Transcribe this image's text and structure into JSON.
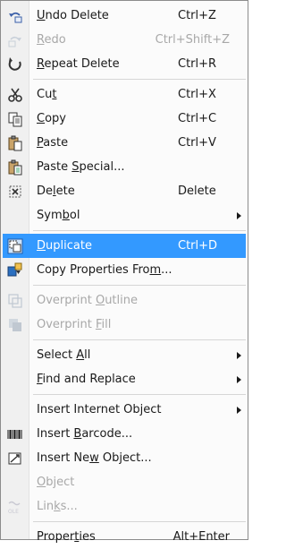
{
  "colors": {
    "highlight": "#3399ff",
    "disabled_text": "#a8a8a8"
  },
  "menu": {
    "groups": [
      [
        {
          "icon": "undo-delete-icon",
          "pre": "",
          "key": "U",
          "post": "ndo Delete",
          "shortcut": "Ctrl+Z",
          "disabled": false
        },
        {
          "icon": "redo-icon",
          "pre": "",
          "key": "R",
          "post": "edo",
          "shortcut": "Ctrl+Shift+Z",
          "disabled": true
        },
        {
          "icon": "repeat-delete-icon",
          "pre": "",
          "key": "R",
          "post": "epeat Delete",
          "shortcut": "Ctrl+R",
          "disabled": false
        }
      ],
      [
        {
          "icon": "scissors-icon",
          "pre": "Cu",
          "key": "t",
          "post": "",
          "shortcut": "Ctrl+X",
          "disabled": false
        },
        {
          "icon": "copy-icon",
          "pre": "",
          "key": "C",
          "post": "opy",
          "shortcut": "Ctrl+C",
          "disabled": false
        },
        {
          "icon": "paste-icon",
          "pre": "",
          "key": "P",
          "post": "aste",
          "shortcut": "Ctrl+V",
          "disabled": false
        },
        {
          "icon": "paste-special-icon",
          "pre": "Paste ",
          "key": "S",
          "post": "pecial...",
          "shortcut": "",
          "disabled": false
        },
        {
          "icon": "delete-icon",
          "pre": "De",
          "key": "l",
          "post": "ete",
          "shortcut": "Delete",
          "disabled": false
        },
        {
          "icon": "",
          "pre": "Sym",
          "key": "b",
          "post": "ol",
          "shortcut": "",
          "submenu": true,
          "disabled": false
        }
      ],
      [
        {
          "icon": "duplicate-icon",
          "pre": "",
          "key": "D",
          "post": "uplicate",
          "shortcut": "Ctrl+D",
          "disabled": false,
          "highlight": true
        },
        {
          "icon": "copy-properties-icon",
          "pre": "Copy Properties Fro",
          "key": "m",
          "post": "...",
          "shortcut": "",
          "disabled": false
        }
      ],
      [
        {
          "icon": "overprint-outline-icon",
          "pre": "Overprint ",
          "key": "O",
          "post": "utline",
          "shortcut": "",
          "disabled": true
        },
        {
          "icon": "overprint-fill-icon",
          "pre": "Overprint ",
          "key": "F",
          "post": "ill",
          "shortcut": "",
          "disabled": true
        }
      ],
      [
        {
          "icon": "",
          "pre": "Select ",
          "key": "A",
          "post": "ll",
          "shortcut": "",
          "submenu": true,
          "disabled": false
        },
        {
          "icon": "",
          "pre": "",
          "key": "F",
          "post": "ind and Replace",
          "shortcut": "",
          "submenu": true,
          "disabled": false
        }
      ],
      [
        {
          "icon": "",
          "pre": "Insert Internet Object",
          "key": "",
          "post": "",
          "shortcut": "",
          "submenu": true,
          "disabled": false
        },
        {
          "icon": "barcode-icon",
          "pre": "Insert ",
          "key": "B",
          "post": "arcode...",
          "shortcut": "",
          "disabled": false
        },
        {
          "icon": "insert-object-icon",
          "pre": "Insert Ne",
          "key": "w",
          "post": " Object...",
          "shortcut": "",
          "disabled": false
        },
        {
          "icon": "",
          "pre": "",
          "key": "O",
          "post": "bject",
          "shortcut": "",
          "disabled": true
        },
        {
          "icon": "links-icon",
          "pre": "Lin",
          "key": "k",
          "post": "s...",
          "shortcut": "",
          "disabled": true
        }
      ],
      [
        {
          "icon": "",
          "pre": "Proper",
          "key": "t",
          "post": "ies",
          "shortcut": "Alt+Enter",
          "disabled": false
        }
      ]
    ]
  }
}
